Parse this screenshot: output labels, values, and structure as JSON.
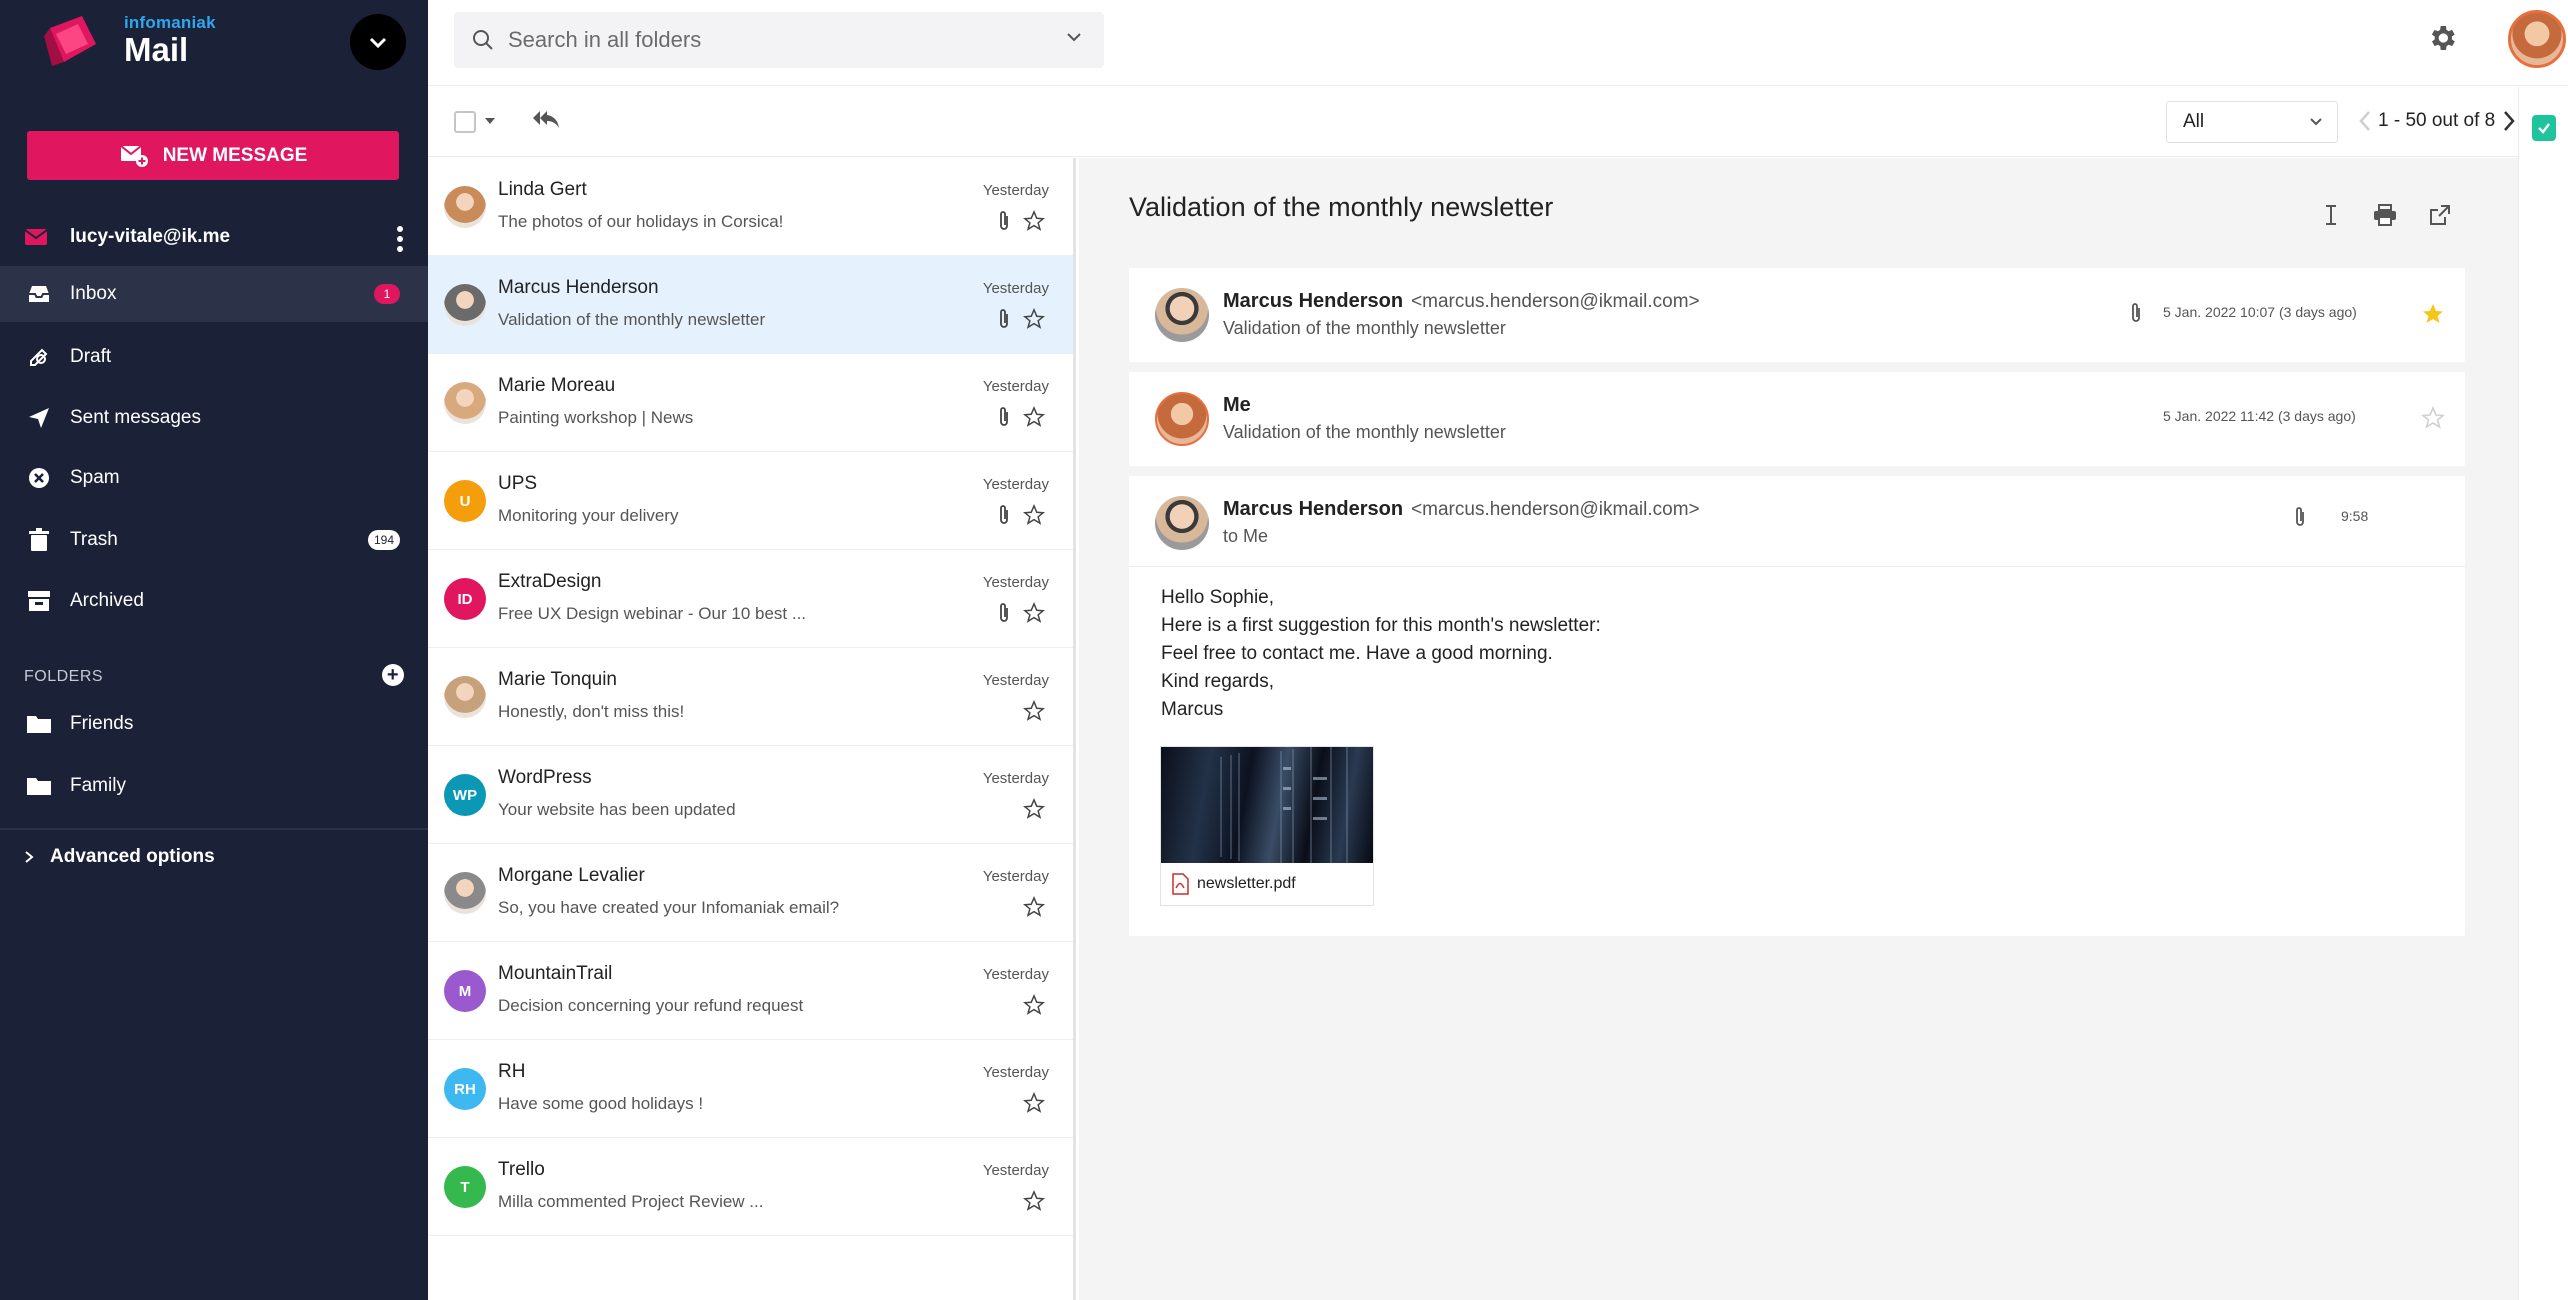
{
  "brand": {
    "sub": "infomaniak",
    "title": "Mail"
  },
  "sidebar": {
    "new_message": "NEW MESSAGE",
    "account": "lucy-vitale@ik.me",
    "nav": [
      {
        "label": "Inbox",
        "badge": "1",
        "icon": "inbox-icon"
      },
      {
        "label": "Draft",
        "badge": "",
        "icon": "draft-icon"
      },
      {
        "label": "Sent messages",
        "badge": "",
        "icon": "send-icon"
      },
      {
        "label": "Spam",
        "badge": "",
        "icon": "spam-icon"
      },
      {
        "label": "Trash",
        "badge": "194",
        "icon": "trash-icon"
      },
      {
        "label": "Archived",
        "badge": "",
        "icon": "archive-icon"
      }
    ],
    "folders_heading": "FOLDERS",
    "folders": [
      {
        "label": "Friends",
        "icon": "folder-icon"
      },
      {
        "label": "Family",
        "icon": "folder-icon"
      }
    ],
    "advanced": "Advanced options"
  },
  "search": {
    "placeholder": "Search in all folders"
  },
  "toolbar": {
    "filter": "All",
    "pager": "1 - 50 out of 8"
  },
  "messages": [
    {
      "sender": "Linda Gert",
      "preview": "The photos of our holidays in Corsica!",
      "date": "Yesterday",
      "attachment": true,
      "avatar": "photo",
      "initials": "",
      "color": "#c98b5a"
    },
    {
      "sender": "Marcus Henderson",
      "preview": "Validation of the monthly newsletter",
      "date": "Yesterday",
      "attachment": true,
      "avatar": "photo",
      "initials": "",
      "color": "#6b6b6b",
      "selected": true
    },
    {
      "sender": "Marie Moreau",
      "preview": "Painting workshop | News",
      "date": "Yesterday",
      "attachment": true,
      "avatar": "photo",
      "initials": "",
      "color": "#d9a97e"
    },
    {
      "sender": "UPS",
      "preview": "Monitoring your delivery",
      "date": "Yesterday",
      "attachment": true,
      "avatar": "initials",
      "initials": "U",
      "color": "#f59e0b"
    },
    {
      "sender": "ExtraDesign",
      "preview": "Free UX Design webinar - Our 10 best ...",
      "date": "Yesterday",
      "attachment": true,
      "avatar": "initials",
      "initials": "ID",
      "color": "#e0175f"
    },
    {
      "sender": "Marie Tonquin",
      "preview": "Honestly, don't miss this!",
      "date": "Yesterday",
      "attachment": false,
      "avatar": "photo",
      "initials": "",
      "color": "#c7a07c"
    },
    {
      "sender": "WordPress",
      "preview": "Your website has been updated",
      "date": "Yesterday",
      "attachment": false,
      "avatar": "initials",
      "initials": "WP",
      "color": "#0a98b5"
    },
    {
      "sender": "Morgane Levalier",
      "preview": "So, you have created your Infomaniak email?",
      "date": "Yesterday",
      "attachment": false,
      "avatar": "photo",
      "initials": "",
      "color": "#8a8a8a"
    },
    {
      "sender": "MountainTrail",
      "preview": "Decision concerning your refund request",
      "date": "Yesterday",
      "attachment": false,
      "avatar": "initials",
      "initials": "M",
      "color": "#9b59d0"
    },
    {
      "sender": "RH",
      "preview": "Have some good holidays !",
      "date": "Yesterday",
      "attachment": false,
      "avatar": "initials",
      "initials": "RH",
      "color": "#3db8f0"
    },
    {
      "sender": "Trello",
      "preview": "Milla commented Project Review ...",
      "date": "Yesterday",
      "attachment": false,
      "avatar": "initials",
      "initials": "T",
      "color": "#35b84e"
    }
  ],
  "reader": {
    "subject": "Validation of the monthly newsletter",
    "thread": [
      {
        "from": "Marcus Henderson",
        "email": "<marcus.henderson@ikmail.com>",
        "sub": "Validation of the monthly newsletter",
        "meta": "5 Jan. 2022 10:07 (3 days ago)",
        "attachment": true,
        "starred": true
      },
      {
        "from": "Me",
        "email": "",
        "sub": "Validation of the monthly newsletter",
        "meta": "5 Jan. 2022 11:42 (3 days ago)",
        "attachment": false,
        "starred": false
      },
      {
        "from": "Marcus Henderson",
        "email": "<marcus.henderson@ikmail.com>",
        "sub": "to Me",
        "meta": "9:58",
        "attachment": true,
        "starred": false
      }
    ],
    "body": [
      "Hello Sophie,",
      "Here is a first suggestion for this month's newsletter:",
      "Feel free to contact me. Have a good morning.",
      "Kind regards,",
      "Marcus"
    ],
    "attachment_name": "newsletter.pdf"
  },
  "colors": {
    "sidebar": "#1b2136",
    "accent": "#e0175f",
    "brand_blue": "#2fa7f0",
    "selected_row": "#e5f1fc",
    "star": "#f5c518"
  }
}
